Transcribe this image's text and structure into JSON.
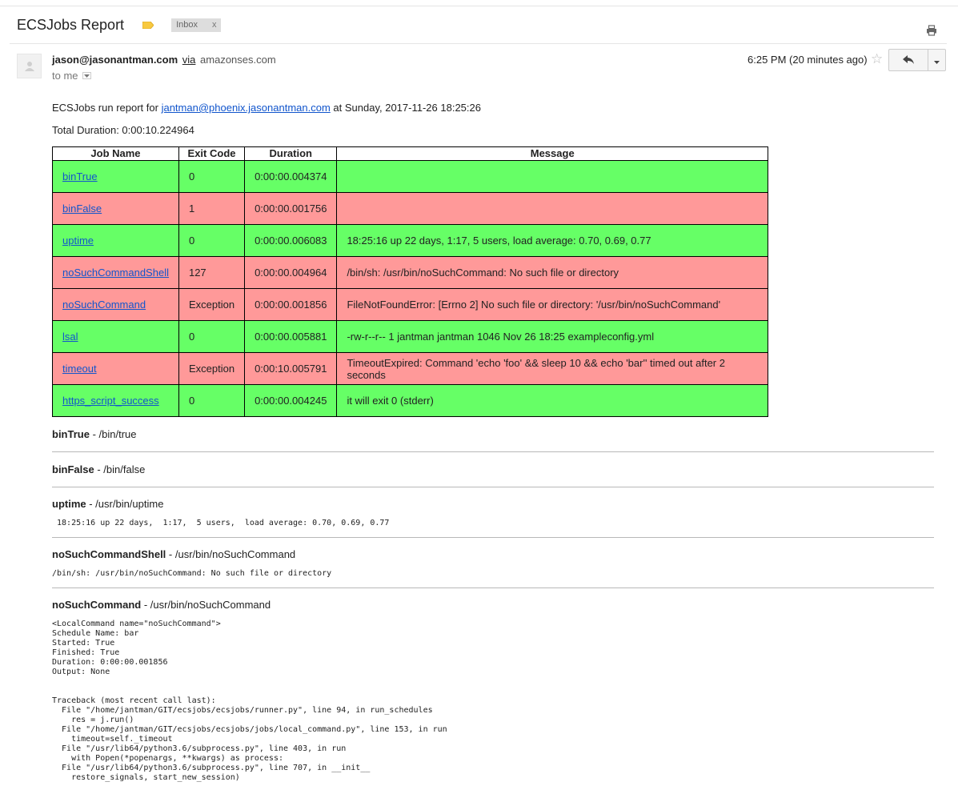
{
  "subject": "ECSJobs Report",
  "label": "Inbox",
  "label_close": "x",
  "sender": {
    "email": "jason@jasonantman.com",
    "via": "via",
    "via_domain": "amazonses.com",
    "to": "to me",
    "timestamp": "6:25 PM (20 minutes ago)"
  },
  "intro": {
    "prefix": "ECSJobs run report for",
    "link": "jantman@phoenix.jasonantman.com",
    "suffix": "at Sunday, 2017-11-26 18:25:26"
  },
  "total_duration": "Total Duration: 0:00:10.224964",
  "table": {
    "headers": [
      "Job Name",
      "Exit Code",
      "Duration",
      "Message"
    ],
    "rows": [
      {
        "name": "binTrue",
        "code": "0",
        "duration": "0:00:00.004374",
        "message": ""
      },
      {
        "name": "binFalse",
        "code": "1",
        "duration": "0:00:00.001756",
        "message": ""
      },
      {
        "name": "uptime",
        "code": "0",
        "duration": "0:00:00.006083",
        "message": "18:25:16 up 22 days, 1:17, 5 users, load average: 0.70, 0.69, 0.77"
      },
      {
        "name": "noSuchCommandShell",
        "code": "127",
        "duration": "0:00:00.004964",
        "message": "/bin/sh: /usr/bin/noSuchCommand: No such file or directory"
      },
      {
        "name": "noSuchCommand",
        "code": "Exception",
        "duration": "0:00:00.001856",
        "message": "FileNotFoundError: [Errno 2] No such file or directory: '/usr/bin/noSuchCommand'"
      },
      {
        "name": "lsal",
        "code": "0",
        "duration": "0:00:00.005881",
        "message": "-rw-r--r-- 1 jantman jantman 1046 Nov 26 18:25 exampleconfig.yml"
      },
      {
        "name": "timeout",
        "code": "Exception",
        "duration": "0:00:10.005791",
        "message": "TimeoutExpired: Command 'echo 'foo' && sleep 10 && echo 'bar'' timed out after 2 seconds"
      },
      {
        "name": "https_script_success",
        "code": "0",
        "duration": "0:00:00.004245",
        "message": "it will exit 0 (stderr)"
      }
    ]
  },
  "details": [
    {
      "name": "binTrue",
      "cmd": " - /bin/true",
      "output": ""
    },
    {
      "name": "binFalse",
      "cmd": " - /bin/false",
      "output": ""
    },
    {
      "name": "uptime",
      "cmd": " - /usr/bin/uptime",
      "output": " 18:25:16 up 22 days,  1:17,  5 users,  load average: 0.70, 0.69, 0.77"
    },
    {
      "name": "noSuchCommandShell",
      "cmd": " - /usr/bin/noSuchCommand",
      "output": "/bin/sh: /usr/bin/noSuchCommand: No such file or directory"
    },
    {
      "name": "noSuchCommand",
      "cmd": " - /usr/bin/noSuchCommand",
      "output": "<LocalCommand name=\"noSuchCommand\">\nSchedule Name: bar\nStarted: True\nFinished: True\nDuration: 0:00:00.001856\nOutput: None\n\n\nTraceback (most recent call last):\n  File \"/home/jantman/GIT/ecsjobs/ecsjobs/runner.py\", line 94, in run_schedules\n    res = j.run()\n  File \"/home/jantman/GIT/ecsjobs/ecsjobs/jobs/local_command.py\", line 153, in run\n    timeout=self._timeout\n  File \"/usr/lib64/python3.6/subprocess.py\", line 403, in run\n    with Popen(*popenargs, **kwargs) as process:\n  File \"/usr/lib64/python3.6/subprocess.py\", line 707, in __init__\n    restore_signals, start_new_session)"
    }
  ],
  "colors": {
    "success": "#66ff66",
    "failure": "#ff9999",
    "link": "#1155cc"
  },
  "icons": [
    "label-icon",
    "print-icon",
    "avatar-icon",
    "dropdown-icon",
    "star-icon",
    "reply-icon",
    "more-icon"
  ]
}
